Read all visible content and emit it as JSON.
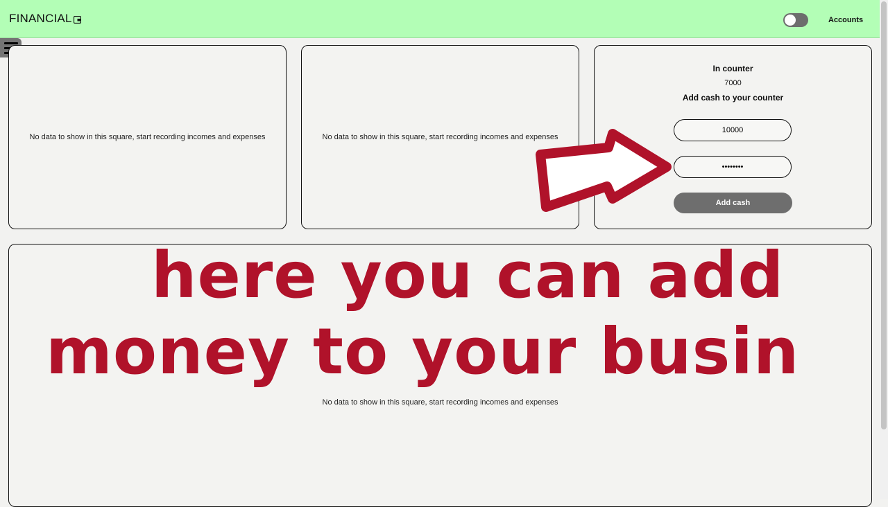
{
  "header": {
    "brand": "FINANCIAL",
    "accounts_label": "Accounts"
  },
  "cards": {
    "empty_message": "No data to show in this square, start recording incomes and expenses"
  },
  "counter": {
    "title": "In counter",
    "value": "7000",
    "subtitle": "Add cash to your counter",
    "amount_value": "10000",
    "password_value": "••••••••",
    "add_button_label": "Add cash"
  },
  "overlay": {
    "line1": "here you can add",
    "line2": "money to your busin",
    "color": "#b0122a"
  },
  "icons": {
    "wallet": "wallet-icon",
    "menu": "hamburger-menu-icon",
    "arrow": "arrow-right-icon"
  }
}
